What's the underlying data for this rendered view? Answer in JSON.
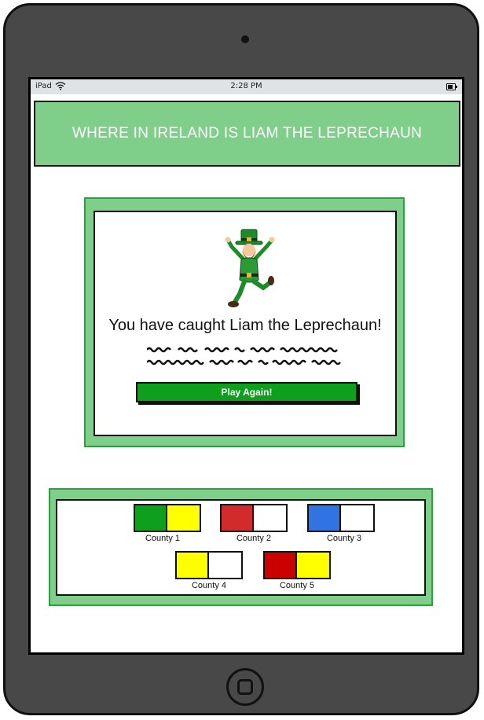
{
  "statusbar": {
    "carrier": "iPad",
    "time": "2:28 PM"
  },
  "header": {
    "title": "WHERE IN IRELAND IS LIAM THE LEPRECHAUN"
  },
  "modal": {
    "image_icon": "leprechaun-illustration",
    "message": "You have caught Liam the Leprechaun!",
    "play_again_label": "Play Again!"
  },
  "legend": {
    "counties": [
      {
        "label": "County 1",
        "colors": [
          "#0ea01d",
          "#ffff00"
        ]
      },
      {
        "label": "County 2",
        "colors": [
          "#d22b2b",
          "#ffffff"
        ]
      },
      {
        "label": "County 3",
        "colors": [
          "#2f74e0",
          "#ffffff"
        ]
      },
      {
        "label": "County 4",
        "colors": [
          "#ffff00",
          "#ffffff"
        ]
      },
      {
        "label": "County 5",
        "colors": [
          "#cc0000",
          "#ffff00"
        ]
      }
    ]
  },
  "colors": {
    "header_bg": "#7fce8a",
    "panel_border": "#2aa43a",
    "button_bg": "#0ea01d",
    "device_frame": "#484848"
  }
}
